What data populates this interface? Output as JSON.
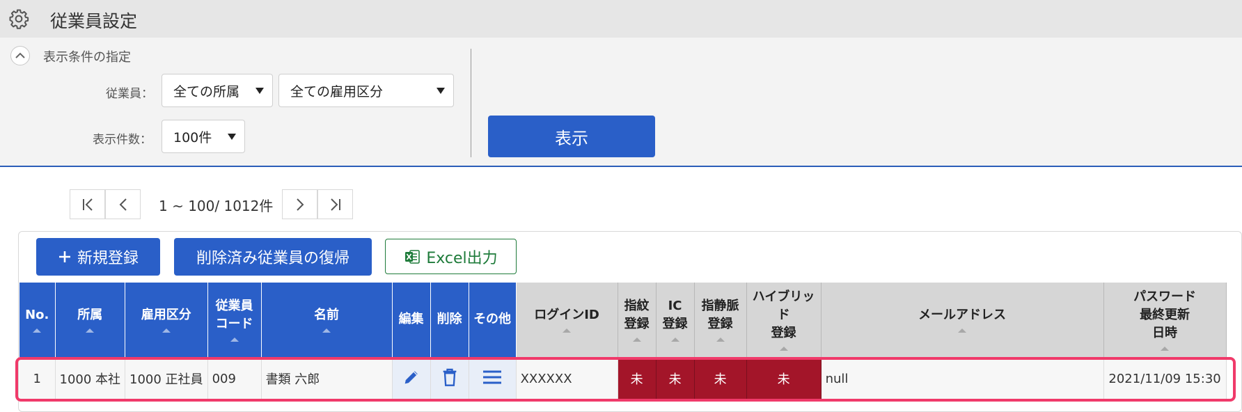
{
  "header": {
    "title": "従業員設定",
    "icon": "gear-icon"
  },
  "filter": {
    "section_title": "表示条件の指定",
    "employee_label": "従業員：",
    "affiliation_select": "全ての所属",
    "employment_select": "全ての雇用区分",
    "count_label": "表示件数：",
    "count_select": "100件",
    "show_button": "表示"
  },
  "pagination": {
    "range_text": "1 ~ 100/ 1012件"
  },
  "toolbar": {
    "new_button": "新規登録",
    "restore_button": "削除済み従業員の復帰",
    "excel_button": "Excel出力"
  },
  "table": {
    "headers": {
      "no": "No.",
      "affiliation": "所属",
      "employment": "雇用区分",
      "code_1": "従業員",
      "code_2": "コード",
      "name": "名前",
      "edit": "編集",
      "delete": "削除",
      "other": "その他",
      "login_id": "ログインID",
      "finger_1": "指紋",
      "finger_2": "登録",
      "ic_1": "IC",
      "ic_2": "登録",
      "vein_1": "指静脈",
      "vein_2": "登録",
      "hybrid_1": "ハイブリッド",
      "hybrid_2": "登録",
      "email": "メールアドレス",
      "pw_1": "パスワード",
      "pw_2": "最終更新",
      "pw_3": "日時"
    },
    "rows": [
      {
        "no": "1",
        "affiliation": "1000 本社",
        "employment": "1000 正社員",
        "code": "009",
        "name": "書類 六郎",
        "login_id": "XXXXXX",
        "finger": "未",
        "ic": "未",
        "vein": "未",
        "hybrid": "未",
        "email": "null",
        "pw_updated": "2021/11/09 15:30"
      }
    ]
  },
  "colors": {
    "primary": "#2a5fc8",
    "unregistered": "#a31529",
    "excel": "#1e7b3a",
    "highlight": "#f03a6a"
  }
}
